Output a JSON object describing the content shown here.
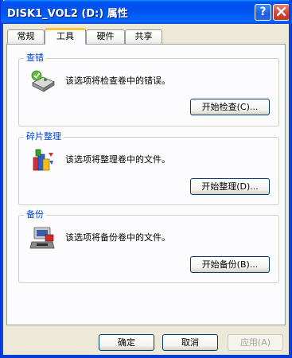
{
  "window": {
    "title": "DISK1_VOL2 (D:) 属性"
  },
  "tabs": [
    {
      "label": "常规"
    },
    {
      "label": "工具"
    },
    {
      "label": "硬件"
    },
    {
      "label": "共享"
    }
  ],
  "groups": [
    {
      "title": "查错",
      "description": "该选项将检查卷中的错误。",
      "button": "开始检查(C)...",
      "icon": "check-disk-icon"
    },
    {
      "title": "碎片整理",
      "description": "该选项将整理卷中的文件。",
      "button": "开始整理(D)...",
      "icon": "defrag-icon"
    },
    {
      "title": "备份",
      "description": "该选项将备份卷中的文件。",
      "button": "开始备份(B)...",
      "icon": "backup-icon"
    }
  ],
  "footer": {
    "ok": "确定",
    "cancel": "取消",
    "apply": "应用(A)"
  },
  "colors": {
    "title_bar": "#0053ee",
    "group_title": "#0046d5",
    "active_tab_accent": "#ffc83c"
  }
}
